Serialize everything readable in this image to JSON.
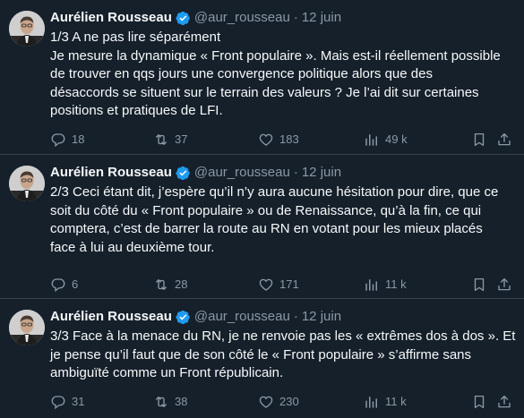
{
  "colors": {
    "background": "#15202b",
    "text": "#f7f9f9",
    "secondary": "#8b98a5",
    "divider": "#38444d",
    "verified": "#1d9bf0"
  },
  "tweets": [
    {
      "author": "Aurélien Rousseau",
      "handle": "@aur_rousseau",
      "separator": "·",
      "date": "12 juin",
      "verified_icon": "verified-badge-icon",
      "text": "1/3 A ne pas lire séparément\nJe mesure la dynamique « Front populaire ». Mais est-il réellement possible\nde trouver en qqs jours une convergence politique alors que des\ndésaccords se situent sur le terrain des valeurs ? Je l’ai dit sur certaines\npositions et pratiques de LFI.",
      "stats": {
        "replies": "18",
        "retweets": "37",
        "likes": "183",
        "views": "49 k"
      }
    },
    {
      "author": "Aurélien Rousseau",
      "handle": "@aur_rousseau",
      "separator": "·",
      "date": "12 juin",
      "verified_icon": "verified-badge-icon",
      "text": "2/3 Ceci étant dit, j’espère qu’il n’y aura aucune hésitation pour dire, que ce\nsoit du côté du « Front populaire » ou de Renaissance, qu’à la fin, ce qui\ncomptera, c’est de barrer la route au RN en votant pour les mieux placés\nface à lui au deuxième tour.",
      "stats": {
        "replies": "6",
        "retweets": "28",
        "likes": "171",
        "views": "11 k"
      }
    },
    {
      "author": "Aurélien Rousseau",
      "handle": "@aur_rousseau",
      "separator": "·",
      "date": "12 juin",
      "verified_icon": "verified-badge-icon",
      "text": "3/3 Face à la menace du RN, je ne renvoie pas les « extrêmes dos à dos ». Et\nje pense qu’il faut que de son côté le « Front populaire » s’affirme sans\nambiguïté comme un Front républicain.",
      "stats": {
        "replies": "31",
        "retweets": "38",
        "likes": "230",
        "views": "11 k"
      }
    }
  ]
}
